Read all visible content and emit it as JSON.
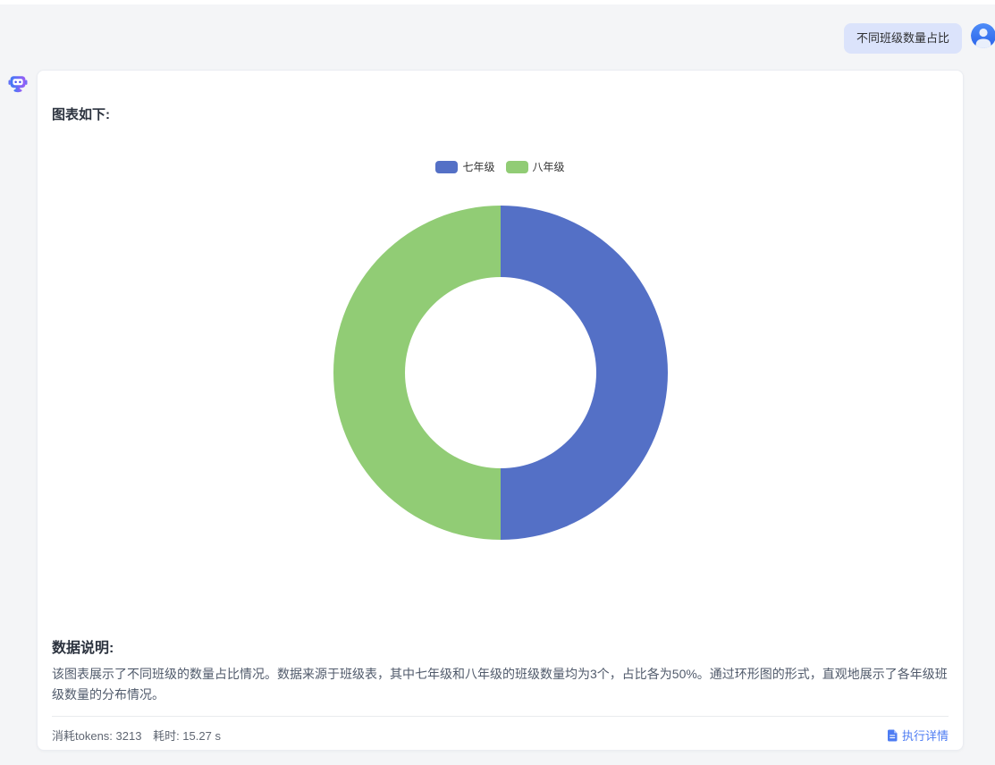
{
  "page": {
    "background_color": "#f4f5f7",
    "card_color": "#ffffff"
  },
  "user_message": {
    "text": "不同班级数量占比",
    "bubble_color": "#dbe3fb"
  },
  "icons": {
    "bot": "robot-chat-icon",
    "user_avatar": "person-avatar-icon",
    "details": "document-file-icon"
  },
  "card": {
    "chart_heading": "图表如下:",
    "note_heading": "数据说明:",
    "note_body": "该图表展示了不同班级的数量占比情况。数据来源于班级表，其中七年级和八年级的班级数量均为3个，占比各为50%。通过环形图的形式，直观地展示了各年级班级数量的分布情况。",
    "footer": {
      "tokens_text": "消耗tokens: 3213",
      "time_text": "耗时: 15.27 s",
      "details_label": "执行详情"
    }
  },
  "chart_data": {
    "type": "pie",
    "variant": "donut",
    "title": "",
    "legend_position": "top",
    "legend": [
      "七年级",
      "八年级"
    ],
    "series": [
      {
        "name": "七年级",
        "value": 3,
        "percent": 50,
        "color": "#5470C6"
      },
      {
        "name": "八年级",
        "value": 3,
        "percent": 50,
        "color": "#91CC75"
      }
    ],
    "outer_radius_px": 187,
    "inner_radius_px": 107,
    "inner_radius_ratio": 0.57,
    "start_angle_deg": -90,
    "direction": "clockwise",
    "center_label": ""
  }
}
